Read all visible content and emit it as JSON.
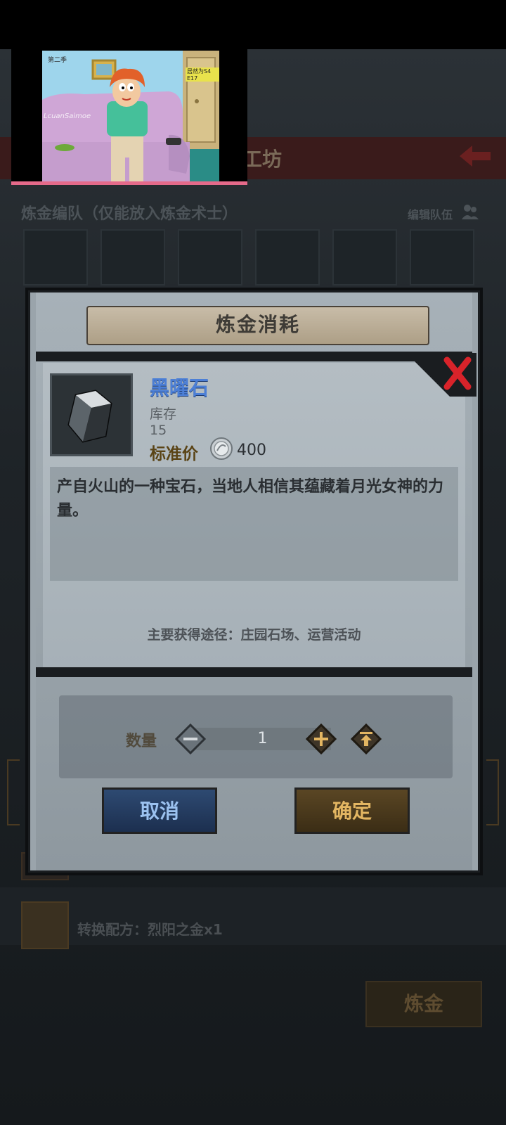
{
  "background": {
    "header_title": "工坊",
    "team_label": "炼金编队（仅能放入炼金术士）",
    "edit_team_label": "编辑队伍",
    "recipe_label": "转换配方：烈阳之金x1",
    "alchemy_button": "炼金"
  },
  "video": {
    "watermark": "LcuanSaimoe",
    "corner_text": "第二季",
    "episode_tag": "居然为S4 E17"
  },
  "dialog": {
    "title": "炼金消耗",
    "item_name": "黑曜石",
    "stock_label": "库存",
    "stock_value": "15",
    "price_label": "标准价",
    "price_value": "400",
    "description": "产自火山的一种宝石，当地人相信其蕴藏着月光女神的力量。",
    "source": "主要获得途径：庄园石场、运营活动",
    "quantity_label": "数量",
    "quantity_value": "1",
    "cancel_label": "取消",
    "confirm_label": "确定"
  },
  "colors": {
    "item_name": "#4c7fd6",
    "confirm": "#e3b662",
    "cancel": "#9cc2f0",
    "close": "#d8232a"
  }
}
